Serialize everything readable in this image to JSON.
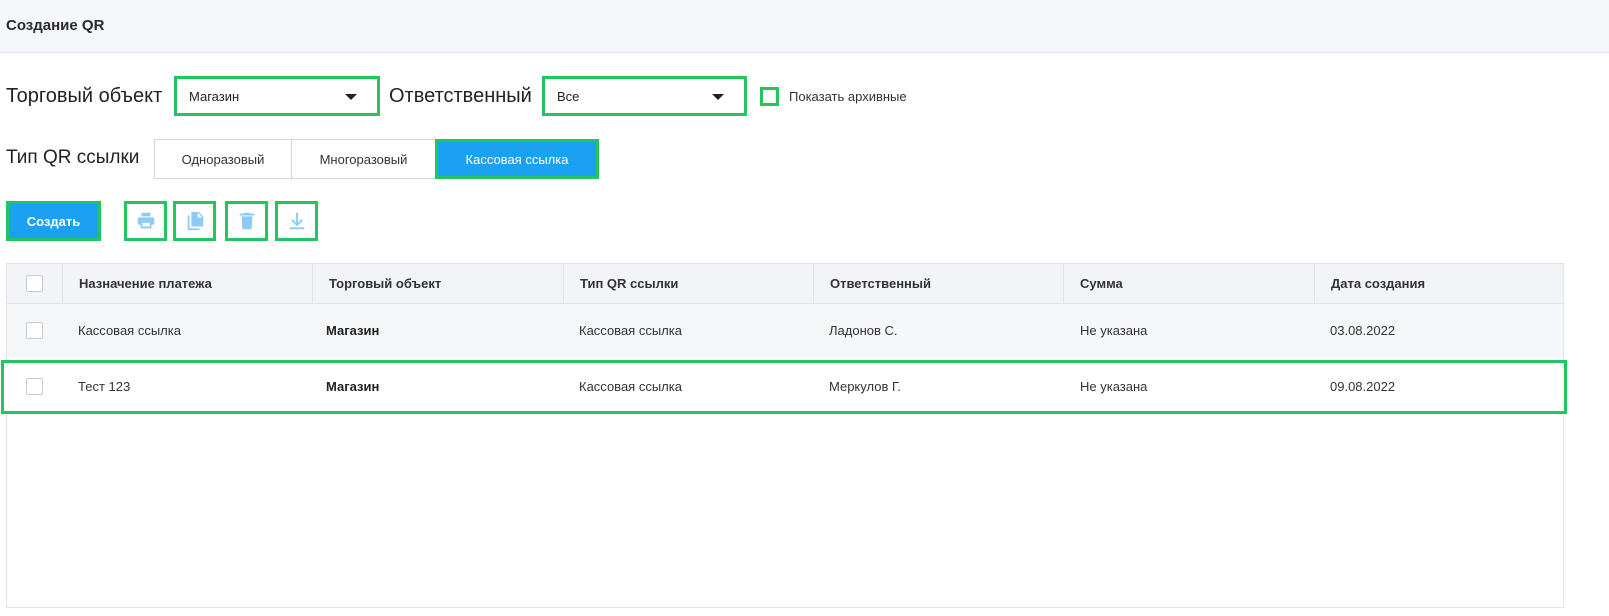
{
  "header": {
    "title": "Создание QR"
  },
  "filters": {
    "trade_object_label": "Торговый объект",
    "trade_object_value": "Магазин",
    "responsible_label": "Ответственный",
    "responsible_value": "Все",
    "show_archived_label": "Показать архивные"
  },
  "qr_type": {
    "label": "Тип QR ссылки",
    "options": [
      "Одноразовый",
      "Многоразовый",
      "Кассовая ссылка"
    ],
    "selected": "Кассовая ссылка"
  },
  "toolbar": {
    "create_label": "Создать",
    "icons": [
      "print-icon",
      "copy-icon",
      "delete-icon",
      "download-icon"
    ]
  },
  "table": {
    "columns": [
      "Назначение платежа",
      "Торговый объект",
      "Тип QR ссылки",
      "Ответственный",
      "Сумма",
      "Дата создания"
    ],
    "rows": [
      [
        "Кассовая ссылка",
        "Магазин",
        "Кассовая ссылка",
        "Ладонов С.",
        "Не указана",
        "03.08.2022"
      ],
      [
        "Тест 123",
        "Магазин",
        "Кассовая ссылка",
        "Меркулов Г.",
        "Не указана",
        "09.08.2022"
      ]
    ]
  },
  "colors": {
    "accent": "#1ba1f2",
    "highlight": "#22c55e",
    "icon": "#8ccbf3"
  }
}
